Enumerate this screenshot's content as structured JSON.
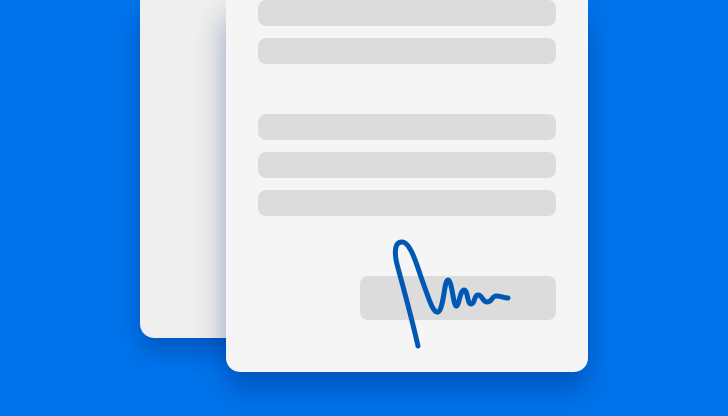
{
  "colors": {
    "background": "#0074ec",
    "paper": "#f5f5f5",
    "paper_back": "#efefef",
    "placeholder_line": "#dcdcdc",
    "signature_ink": "#0058b5"
  },
  "icons": {
    "back_document": "document-sheet-icon",
    "front_document": "document-sheet-icon",
    "signature": "handwritten-signature-icon"
  }
}
